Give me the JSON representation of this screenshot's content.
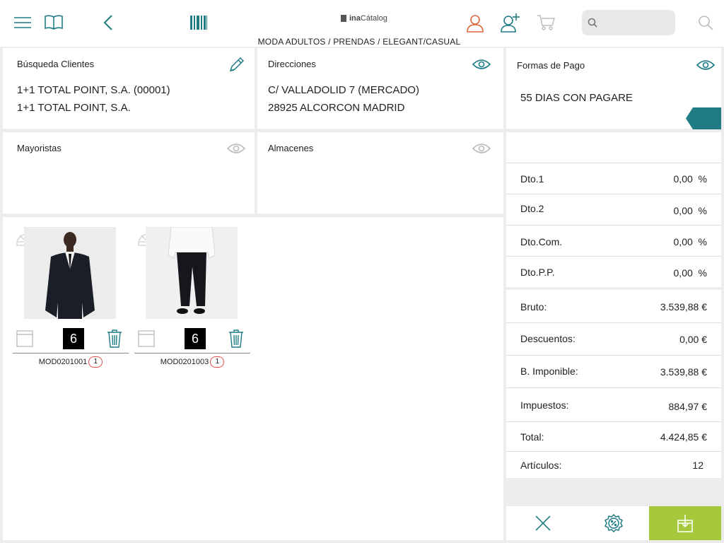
{
  "header": {
    "brand_bold": "ina",
    "brand_rest": "Cátalog",
    "breadcrumb": "MODA ADULTOS / PRENDAS / ELEGANT/CASUAL",
    "search_placeholder": ""
  },
  "cards": {
    "clientes": {
      "title": "Búsqueda Clientes",
      "line1": "1+1 TOTAL POINT, S.A. (00001)",
      "line2": "1+1 TOTAL POINT, S.A."
    },
    "direcciones": {
      "title": "Direcciones",
      "line1": "C/ VALLADOLID 7 (MERCADO)",
      "line2": "28925 ALCORCON MADRID"
    },
    "pago": {
      "title": "Formas de Pago",
      "line1": "55 DIAS CON PAGARE"
    },
    "mayoristas": {
      "title": "Mayoristas"
    },
    "almacenes": {
      "title": "Almacenes"
    }
  },
  "discounts": [
    {
      "label": "Dto.1",
      "value": "0,00  %"
    },
    {
      "label": "Dto.2",
      "value": "0,00  %"
    },
    {
      "label": "Dto.Com.",
      "value": "0,00  %"
    },
    {
      "label": "Dto.P.P.",
      "value": "0,00  %"
    }
  ],
  "totals": [
    {
      "label": "Bruto:",
      "value": "3.539,88 €"
    },
    {
      "label": "Descuentos:",
      "value": "0,00 €"
    },
    {
      "label": "B. Imponible:",
      "value": "3.539,88 €"
    },
    {
      "label": "Impuestos:",
      "value": "884,97 €"
    },
    {
      "label": "Total:",
      "value": "4.424,85 €"
    },
    {
      "label": "Artículos:",
      "value": "12"
    }
  ],
  "products": [
    {
      "code": "MOD0201001",
      "qty": "6",
      "badge": "1"
    },
    {
      "code": "MOD0201003",
      "qty": "6",
      "badge": "1"
    }
  ],
  "colors": {
    "teal": "#1f7c84",
    "green": "#a6c83b",
    "orange": "#e0673a",
    "badge_red": "#e05050"
  }
}
